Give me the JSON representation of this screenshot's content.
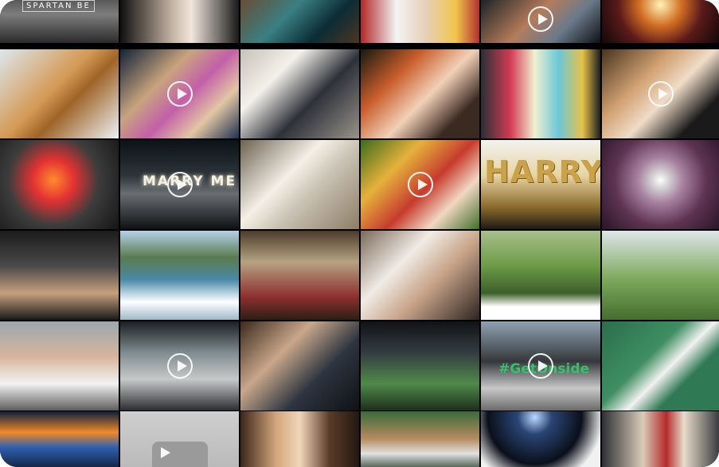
{
  "gallery": {
    "tiles": [
      {
        "id": "r1c1",
        "overlay": "SPARTAN BE",
        "video": false,
        "bg": "linear-gradient(180deg,#4c4c4c,#7d7d7d 40%,#2b2b2b)"
      },
      {
        "id": "r1c2",
        "overlay": "",
        "video": false,
        "bg": "linear-gradient(90deg,#101010,#c8b7a6 45%,#f1e6db 60%,#1a1a1a)"
      },
      {
        "id": "r1c3",
        "overlay": "",
        "video": false,
        "bg": "linear-gradient(135deg,#6b4a2f,#3a7f82 40%,#0b2c35 70%,#4b3524)"
      },
      {
        "id": "r1c4",
        "overlay": "",
        "video": false,
        "bg": "linear-gradient(90deg,#b22727,#f3f3f3 30%,#e6d0b9 55%,#f2c54d 80%,#b33232)"
      },
      {
        "id": "r1c5",
        "overlay": "",
        "video": true,
        "bg": "linear-gradient(135deg,#131c24,#b47c5b 45%,#6a7a8a 70%,#0f1113)"
      },
      {
        "id": "r1c6",
        "overlay": "",
        "video": false,
        "bg": "radial-gradient(circle at 50% 20%,#fff3b8,#d36f24 30%,#5b1a1a 60%,#110809)"
      },
      {
        "id": "r2c1",
        "overlay": "",
        "video": false,
        "bg": "linear-gradient(135deg,#dde6ef,#d49954 45%,#9e6427 60%,#eef2f6)"
      },
      {
        "id": "r2c2",
        "overlay": "",
        "video": true,
        "bg": "linear-gradient(135deg,#13223a,#c8a47e 35%,#c45fa8 55%,#e2c6a3 75%,#1d3050)"
      },
      {
        "id": "r2c3",
        "overlay": "",
        "video": false,
        "bg": "linear-gradient(135deg,#c6c1b8,#f4f1ea 30%,#2d3139 60%,#999389)"
      },
      {
        "id": "r2c4",
        "overlay": "",
        "video": false,
        "bg": "linear-gradient(135deg,#151a12,#c85c2b 30%,#f2d1b8 55%,#3b2a22 80%)"
      },
      {
        "id": "r2c5",
        "overlay": "",
        "video": false,
        "bg": "linear-gradient(90deg,#2a2f35,#d53c55 25%,#f0f0d0 45%,#6bc7d9 65%,#e6c24a 85%,#1b1d20)"
      },
      {
        "id": "r2c6",
        "overlay": "",
        "video": true,
        "bg": "linear-gradient(135deg,#48331c,#d3a374 35%,#f0dcc8 55%,#1a1a1a 80%)"
      },
      {
        "id": "r3c1",
        "overlay": "",
        "video": false,
        "bg": "radial-gradient(circle at 45% 45%,#ff8b2f,#e43232 25%,#3d3d3d 55%,#151515)"
      },
      {
        "id": "r3c2",
        "overlay": "MARRY ME",
        "video": true,
        "bg": "linear-gradient(180deg,#0c1216,#2d353b 40%,#6a6e72 60%,#0e1114)"
      },
      {
        "id": "r3c3",
        "overlay": "",
        "video": false,
        "bg": "linear-gradient(135deg,#6d6251,#f5f0e8 40%,#c9c1b2 60%,#8d7d66)"
      },
      {
        "id": "r3c4",
        "overlay": "",
        "video": true,
        "bg": "linear-gradient(135deg,#3d6b1d,#e5b23b 30%,#c63b2d 55%,#f1d7c2 75%,#3f6e2a)"
      },
      {
        "id": "r3c5",
        "overlay": "HARRY",
        "video": false,
        "bg": "linear-gradient(180deg,#f2f2f0,#e8d4a2 40%,#8d6b2e 75%,#1d1a14)"
      },
      {
        "id": "r3c6",
        "overlay": "",
        "video": false,
        "bg": "radial-gradient(circle at 50% 45%,#ffffff,#d6d6d6 10%,#a780a0 30%,#5e3452 60%,#2a1428)"
      },
      {
        "id": "r4c1",
        "overlay": "",
        "video": false,
        "bg": "linear-gradient(180deg,#1b1b1b,#4a4a4a 40%,#c6a07a 70%,#1a1a1a)"
      },
      {
        "id": "r4c2",
        "overlay": "",
        "video": false,
        "bg": "linear-gradient(180deg,#b4d1ea,#5a7b4e 30%,#4a8aa7 55%,#ffffff 80%,#9fb8c8)"
      },
      {
        "id": "r4c3",
        "overlay": "",
        "video": false,
        "bg": "linear-gradient(180deg,#4b3b2a,#b6a283 35%,#8c2e2e 75%,#2c2014)"
      },
      {
        "id": "r4c4",
        "overlay": "",
        "video": false,
        "bg": "linear-gradient(135deg,#7c6a5a,#f1ece6 35%,#c8a489 60%,#2e2521)"
      },
      {
        "id": "r4c5",
        "overlay": "",
        "video": false,
        "bg": "linear-gradient(180deg,#a8c08b,#6c9a46 40%,#3c5f2a 70%,#ffffff 85%)"
      },
      {
        "id": "r4c6",
        "overlay": "",
        "video": false,
        "bg": "linear-gradient(180deg,#dfe6ea,#7ca85b 55%,#456d2f)"
      },
      {
        "id": "r5c1",
        "overlay": "",
        "video": false,
        "bg": "linear-gradient(180deg,#9aa7b0,#d8b59c 40%,#f2f2f2 70%,#5f5d5c)"
      },
      {
        "id": "r5c2",
        "overlay": "",
        "video": true,
        "bg": "linear-gradient(180deg,#1b1f22,#7f8c8f 35%,#c8c8c8 65%,#2a2d30)"
      },
      {
        "id": "r5c3",
        "overlay": "",
        "video": false,
        "bg": "linear-gradient(135deg,#3b2a1d,#c9a78a 35%,#2d3440 65%,#0f1215)"
      },
      {
        "id": "r5c4",
        "overlay": "",
        "video": false,
        "bg": "linear-gradient(180deg,#101316,#343c41 35%,#4f8a4a 70%,#1d2f1c)"
      },
      {
        "id": "r5c5",
        "overlay": "#GetOnside",
        "video": true,
        "bg": "linear-gradient(180deg,#8fa2b1,#35383b 45%,#c8c8c8 75%,#6a6a6a)"
      },
      {
        "id": "r5c6",
        "overlay": "",
        "video": false,
        "bg": "linear-gradient(135deg,#2b6e4b,#3f8f63 40%,#f1f1f1 55%,#2f7a54 70%)"
      },
      {
        "id": "r6c1",
        "overlay": "",
        "video": false,
        "bg": "linear-gradient(180deg,#0c1f3a,#f08a2a 35%,#2d5fb0 60%,#0d1a2c)"
      },
      {
        "id": "r6c2",
        "overlay": "",
        "video": true,
        "bg": "linear-gradient(180deg,#cfcfcf,#b8b8b8)"
      },
      {
        "id": "r6c3",
        "overlay": "",
        "video": false,
        "bg": "linear-gradient(90deg,#3b2619,#d2a57c 30%,#f0d6b9 50%,#5a3b28 75%,#241811)"
      },
      {
        "id": "r6c4",
        "overlay": "",
        "video": false,
        "bg": "linear-gradient(180deg,#3b6b3a,#b48a5f 45%,#e1e1e1 70%,#2a3b2a)"
      },
      {
        "id": "r6c5",
        "overlay": "",
        "video": false,
        "bg": "radial-gradient(circle at 45% 10%,#b9d9ff,#2a4575 20%,#0b0f1a 55%,#f1f1f1 80%)"
      },
      {
        "id": "r6c6",
        "overlay": "",
        "video": false,
        "bg": "linear-gradient(90deg,#2d2f33,#d9cbb8 35%,#b52a2a 55%,#e8dccb 70%,#3a3d40)"
      }
    ]
  },
  "colors": {
    "frame_background": "#000000",
    "page_background": "#ffffff",
    "play_icon": "#ffffff",
    "getonside_green": "#35c06a"
  }
}
